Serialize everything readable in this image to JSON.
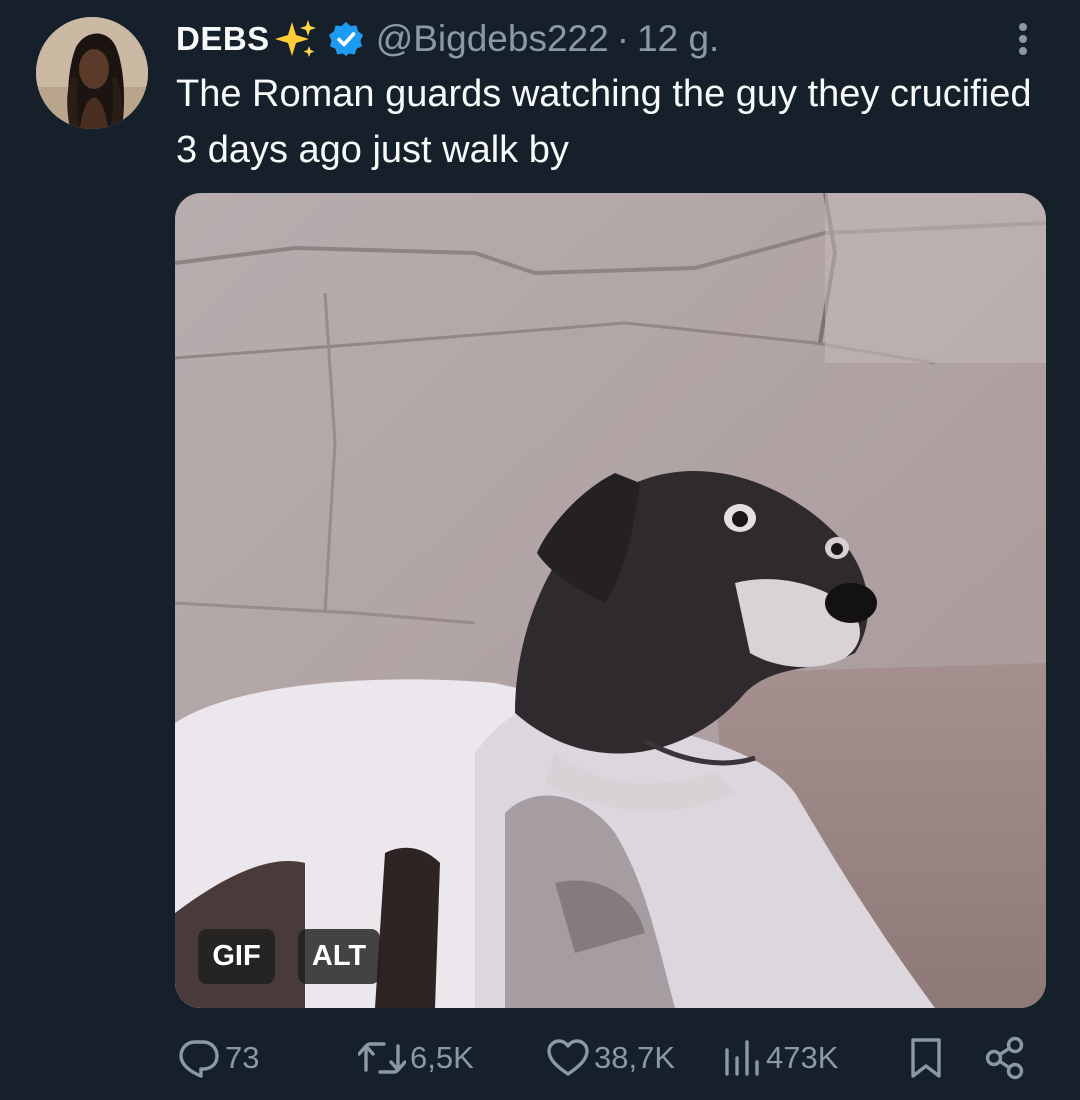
{
  "author": {
    "name": "DEBS",
    "handle": "@Bigdebs222",
    "separator": "·",
    "time": "12 g."
  },
  "tweet": {
    "text": "The Roman guards watching the guy they crucified 3 days ago just walk by"
  },
  "media": {
    "gif_label": "GIF",
    "alt_label": "ALT"
  },
  "actions": {
    "replies": "73",
    "reposts": "6,5K",
    "likes": "38,7K",
    "views": "473K"
  },
  "colors": {
    "background": "#15202b",
    "primary_text": "#f7f9f9",
    "secondary_text": "#8b98a5",
    "verified": "#1d9bf0",
    "sparkles": "#ffcc33"
  },
  "icons": {
    "verified": "verified-badge-icon",
    "sparkles": "sparkles-emoji-icon",
    "more": "more-vertical-icon",
    "reply": "reply-icon",
    "repost": "repost-icon",
    "like": "heart-icon",
    "views": "views-chart-icon",
    "bookmark": "bookmark-icon",
    "share": "share-icon"
  }
}
